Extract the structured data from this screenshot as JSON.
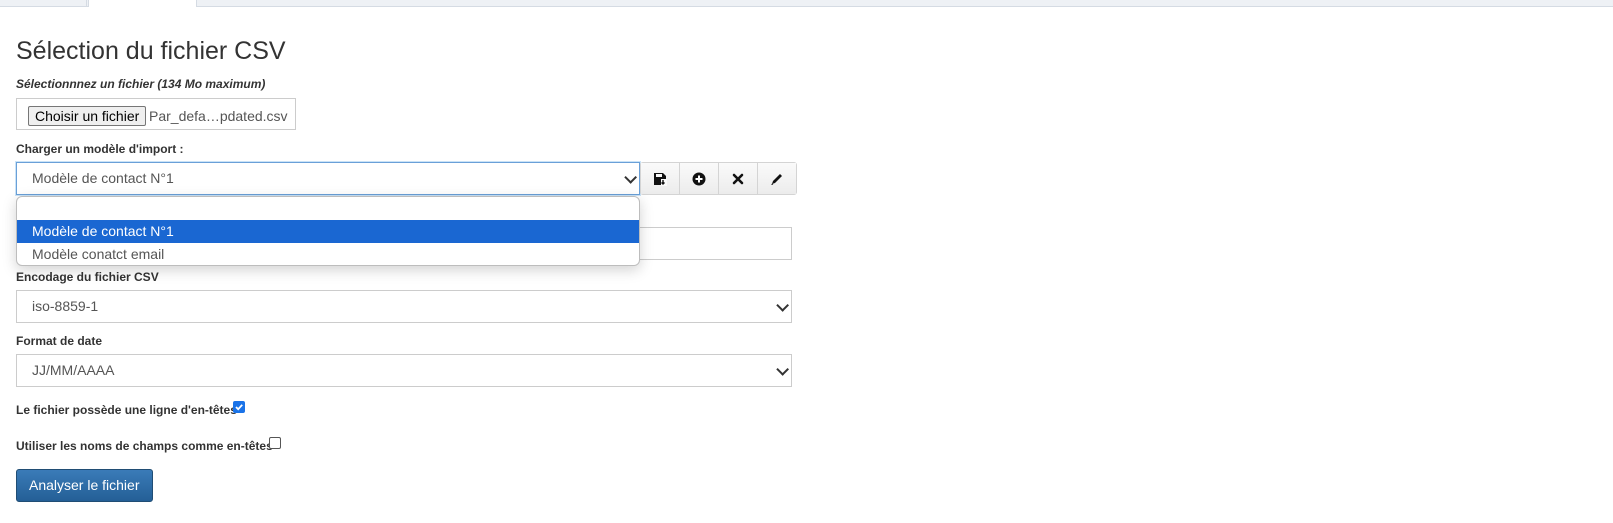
{
  "title": "Sélection du fichier CSV",
  "file": {
    "label": "Sélectionnnez un fichier (134 Mo maximum)",
    "button_label": "Choisir un fichier",
    "file_name": "Par_defa…pdated.csv"
  },
  "model": {
    "label": "Charger un modèle d'import :",
    "selected": "Modèle de contact N°1",
    "options": [
      "",
      "Modèle de contact N°1",
      "Modèle conatct email"
    ],
    "selected_index": 1,
    "actions": [
      "save-icon",
      "add-icon",
      "delete-icon",
      "edit-icon"
    ]
  },
  "encoding": {
    "label": "Encodage du fichier CSV",
    "value": "iso-8859-1"
  },
  "date_format": {
    "label": "Format de date",
    "value": "JJ/MM/AAAA"
  },
  "has_header": {
    "label": "Le fichier possède une ligne d'en-têtes",
    "checked": true
  },
  "field_names_as_headers": {
    "label": "Utiliser les noms de champs comme en-têtes",
    "checked": false
  },
  "submit_label": "Analyser le fichier",
  "colors": {
    "primary": "#2e6da4",
    "highlight": "#1a67d2",
    "checkbox": "#1a73e8"
  }
}
